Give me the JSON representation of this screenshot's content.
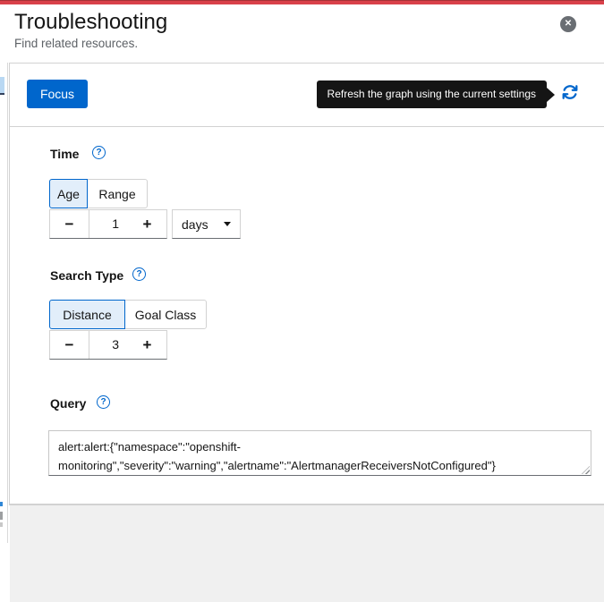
{
  "header": {
    "title": "Troubleshooting",
    "subtitle": "Find related resources."
  },
  "icons": {
    "close": "✕",
    "help": "?",
    "minus": "−",
    "plus": "+"
  },
  "toolbar": {
    "focus_label": "Focus",
    "refresh_tooltip": "Refresh the graph using the current settings"
  },
  "form": {
    "time": {
      "label": "Time",
      "mode_options": [
        "Age",
        "Range"
      ],
      "selected_mode": "Age",
      "value": "1",
      "unit": "days"
    },
    "search_type": {
      "label": "Search Type",
      "mode_options": [
        "Distance",
        "Goal Class"
      ],
      "selected_mode": "Distance",
      "value": "3"
    },
    "query": {
      "label": "Query",
      "value": "alert:alert:{\"namespace\":\"openshift-monitoring\",\"severity\":\"warning\",\"alertname\":\"AlertmanagerReceiversNotConfigured\"}"
    }
  },
  "colors": {
    "accent_bar": "#d9414a",
    "primary_blue": "#0066cc",
    "selected_toggle_bg": "#e2eefa",
    "tooltip_bg": "#151515",
    "panel_border": "#d2d2d2",
    "bottom_area_bg": "#f0f0f0"
  }
}
